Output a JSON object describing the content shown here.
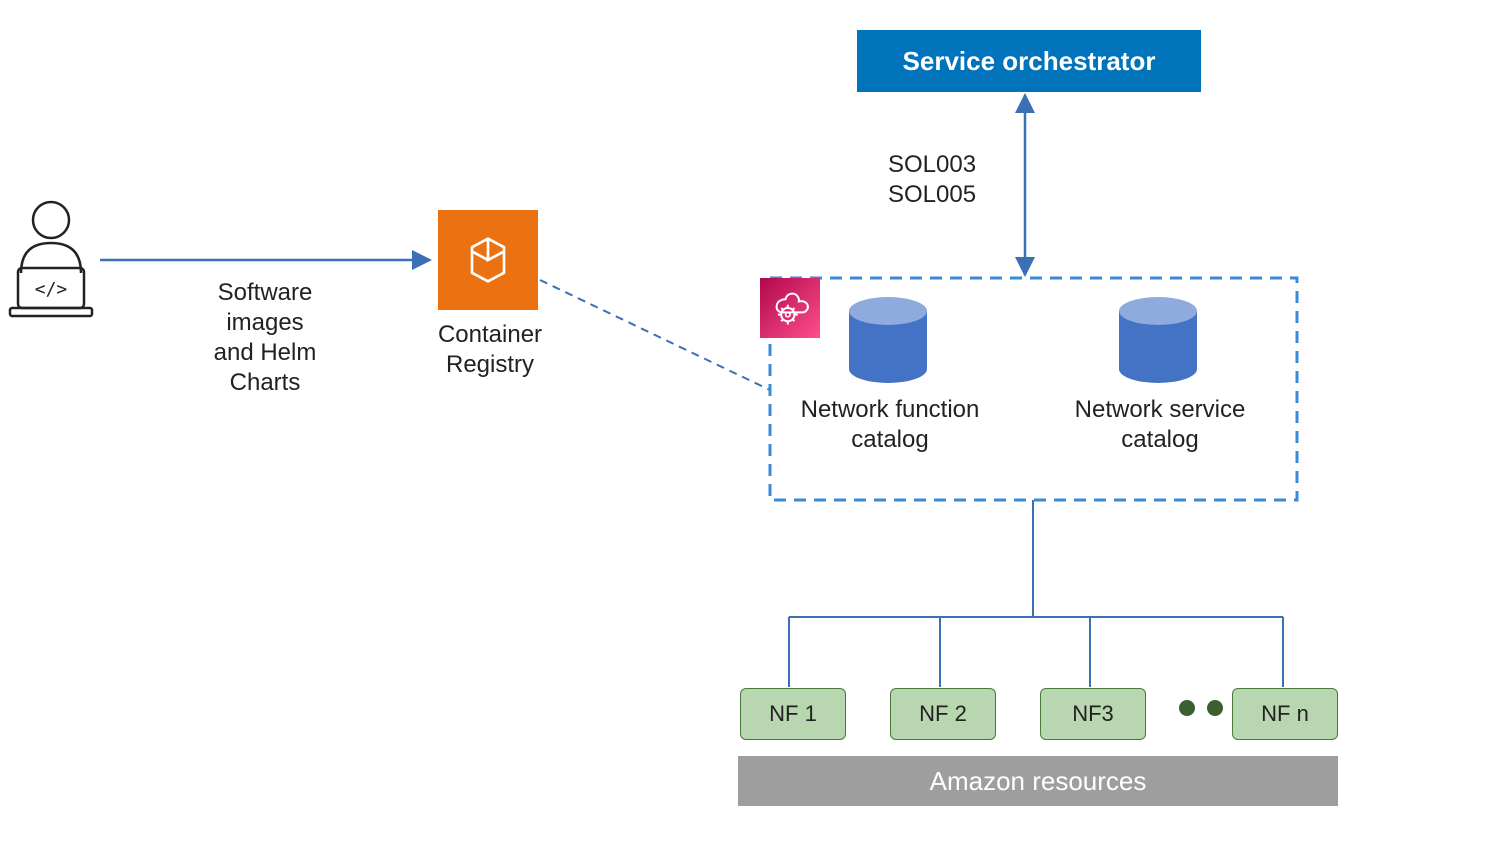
{
  "labels": {
    "orchestrator": "Service orchestrator",
    "sol003": "SOL003",
    "sol005": "SOL005",
    "software_images_1": "Software",
    "software_images_2": "images",
    "software_images_3": "and Helm",
    "software_images_4": "Charts",
    "container_reg_1": "Container",
    "container_reg_2": "Registry",
    "nf_catalog_1": "Network function",
    "nf_catalog_2": "catalog",
    "ns_catalog_1": "Network service",
    "ns_catalog_2": "catalog",
    "nf1": "NF 1",
    "nf2": "NF 2",
    "nf3": "NF3",
    "nfn": "NF n",
    "resources": "Amazon resources"
  },
  "colors": {
    "blue_primary": "#0073bb",
    "arrow_blue": "#3b6fb6",
    "orange": "#ec7211",
    "magenta_start": "#b0084d",
    "magenta_end": "#ff4f8b",
    "db_fill": "#4472c4",
    "db_top": "#8faadc",
    "nf_fill": "#b8d6b0",
    "nf_border": "#4a7a3a",
    "gray": "#9e9e9e"
  }
}
